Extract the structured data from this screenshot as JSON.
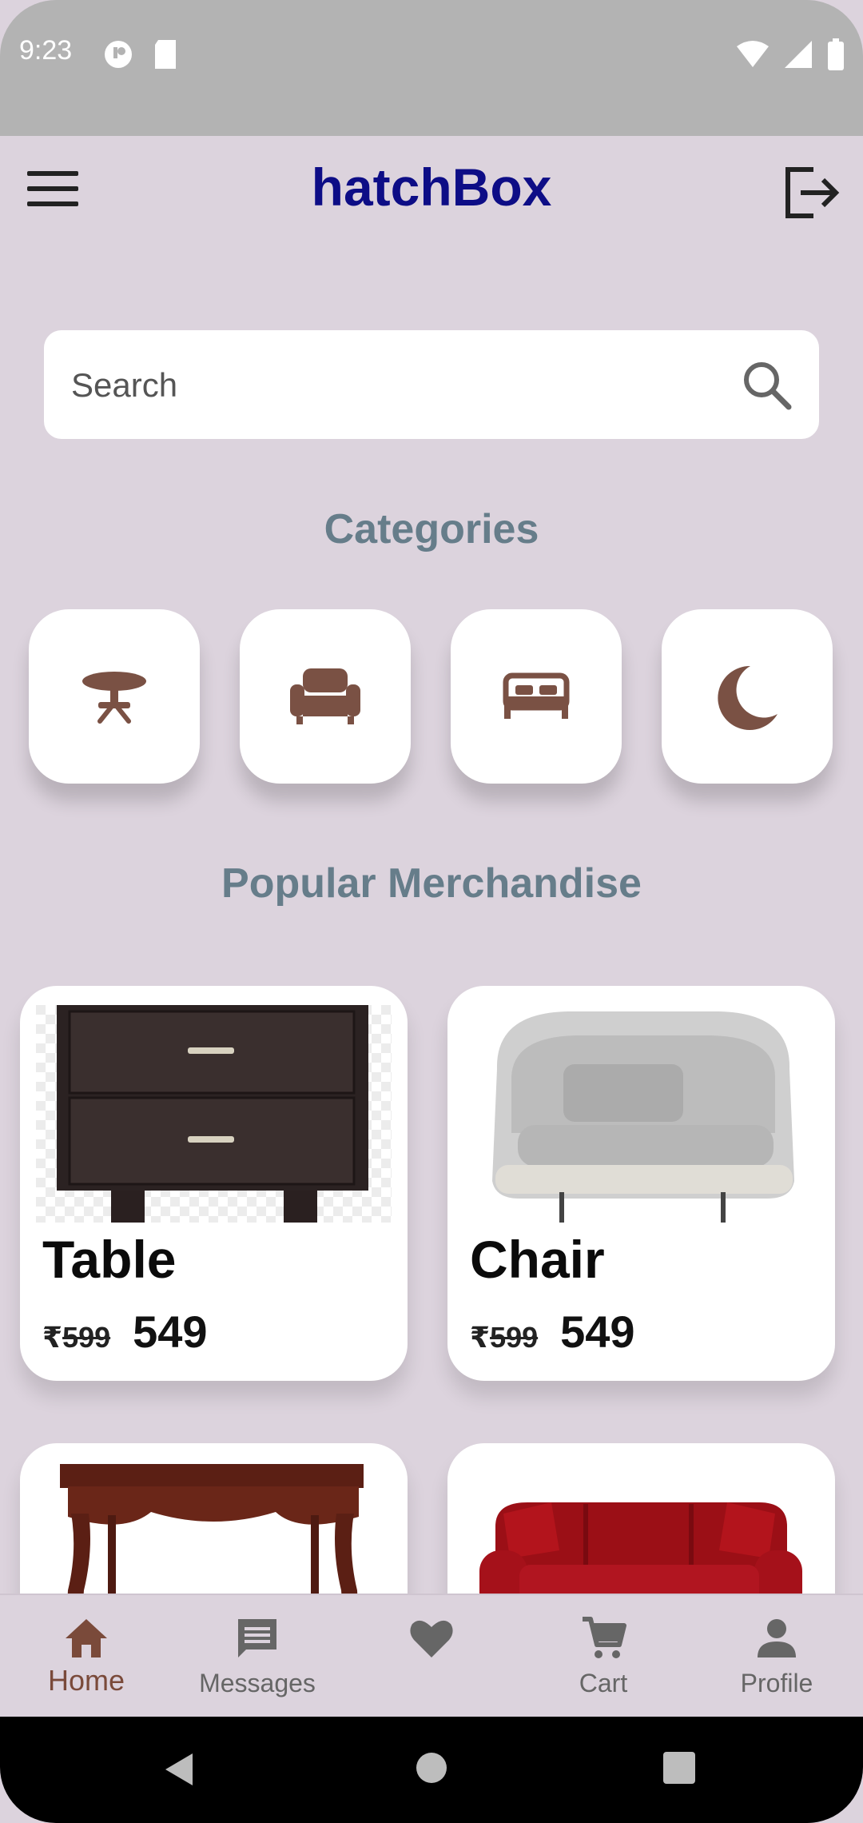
{
  "status_bar": {
    "time": "9:23"
  },
  "app_bar": {
    "title": "hatchBox"
  },
  "search": {
    "placeholder": "Search"
  },
  "sections": {
    "categories_title": "Categories",
    "popular_title": "Popular Merchandise"
  },
  "categories": [
    {
      "icon": "table-icon"
    },
    {
      "icon": "sofa-icon"
    },
    {
      "icon": "bed-icon"
    },
    {
      "icon": "moon-icon"
    }
  ],
  "products": [
    {
      "name": "Table",
      "old_price_symbol": "₹",
      "old_price": "599",
      "new_price": "549",
      "image": "drawer-cabinet-image"
    },
    {
      "name": "Chair",
      "old_price_symbol": "₹",
      "old_price": "599",
      "new_price": "549",
      "image": "armchair-image"
    },
    {
      "image": "wooden-table-image"
    },
    {
      "image": "red-sofa-image"
    }
  ],
  "bottom_nav": {
    "items": [
      {
        "label": "Home",
        "icon": "home-icon",
        "active": true
      },
      {
        "label": "Messages",
        "icon": "message-icon"
      },
      {
        "label": "",
        "icon": "heart-icon"
      },
      {
        "label": "Cart",
        "icon": "cart-icon"
      },
      {
        "label": "Profile",
        "icon": "person-icon"
      }
    ]
  },
  "colors": {
    "background": "#dcd3dd",
    "title": "#0d0d86",
    "section_title": "#667d8a",
    "category_icon": "#7a5144",
    "active_nav": "#7a4a3a"
  }
}
